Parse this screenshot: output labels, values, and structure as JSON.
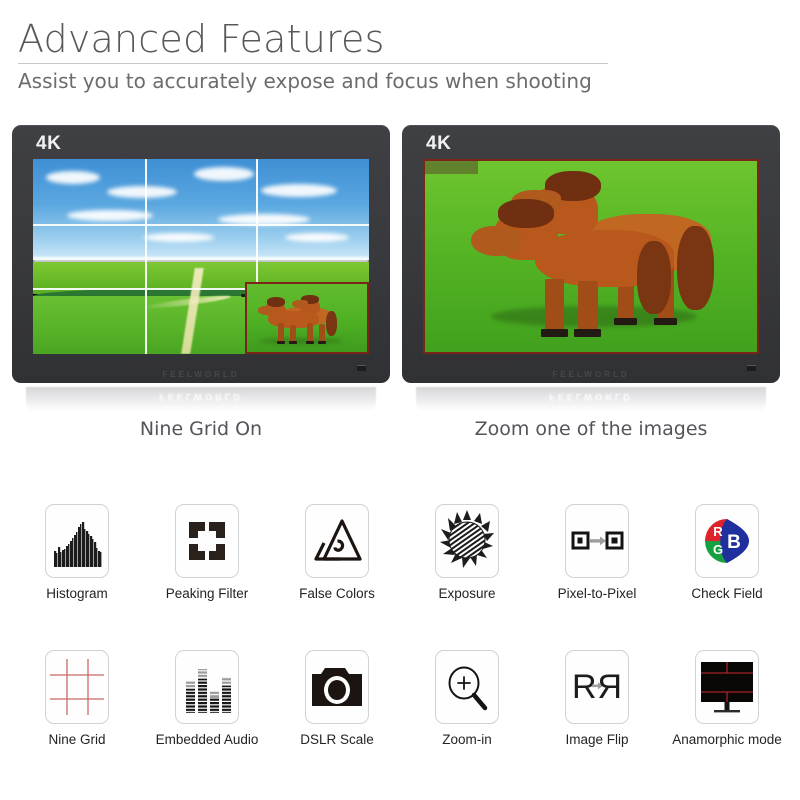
{
  "header": {
    "title": "Advanced Features",
    "subtitle": "Assist you to accurately expose and focus when shooting"
  },
  "showcase": {
    "monitors": [
      {
        "badge": "4K",
        "brand": "FEELWORLD",
        "caption": "Nine Grid On",
        "scene": "grassland-landscape",
        "overlay": "nine-grid",
        "zoom_box_color": "#7b2418"
      },
      {
        "badge": "4K",
        "brand": "FEELWORLD",
        "caption": "Zoom one of the images",
        "scene": "two-horses",
        "overlay": "none",
        "frame_color": "#7b2418"
      }
    ]
  },
  "features": {
    "rows": [
      [
        {
          "label": "Histogram",
          "icon": "histogram-icon"
        },
        {
          "label": "Peaking Filter",
          "icon": "peaking-filter-icon"
        },
        {
          "label": "False Colors",
          "icon": "false-colors-icon"
        },
        {
          "label": "Exposure",
          "icon": "exposure-sun-icon"
        },
        {
          "label": "Pixel-to-Pixel",
          "icon": "pixel-to-pixel-icon"
        },
        {
          "label": "Check Field",
          "icon": "check-field-rgb-icon"
        }
      ],
      [
        {
          "label": "Nine Grid",
          "icon": "nine-grid-icon"
        },
        {
          "label": "Embedded  Audio",
          "icon": "embedded-audio-icon"
        },
        {
          "label": "DSLR Scale",
          "icon": "dslr-camera-icon"
        },
        {
          "label": "Zoom-in",
          "icon": "magnifier-plus-icon"
        },
        {
          "label": "Image Flip",
          "icon": "image-flip-icon"
        },
        {
          "label": "Anamorphic  mode",
          "icon": "anamorphic-monitor-icon"
        }
      ]
    ],
    "check_field_letters": [
      "R",
      "G",
      "B"
    ],
    "image_flip_letters": [
      "R",
      "R"
    ]
  },
  "colors": {
    "title": "#58585a",
    "subtitle": "#6c6c6e",
    "bezel": "#3a3b3f",
    "grid_line": "#ffffff",
    "accent_red": "#7b2418",
    "nine_grid_red": "#c96a63",
    "check_r": "#e0232b",
    "check_g": "#17a03f",
    "check_b": "#1f2f9e"
  }
}
